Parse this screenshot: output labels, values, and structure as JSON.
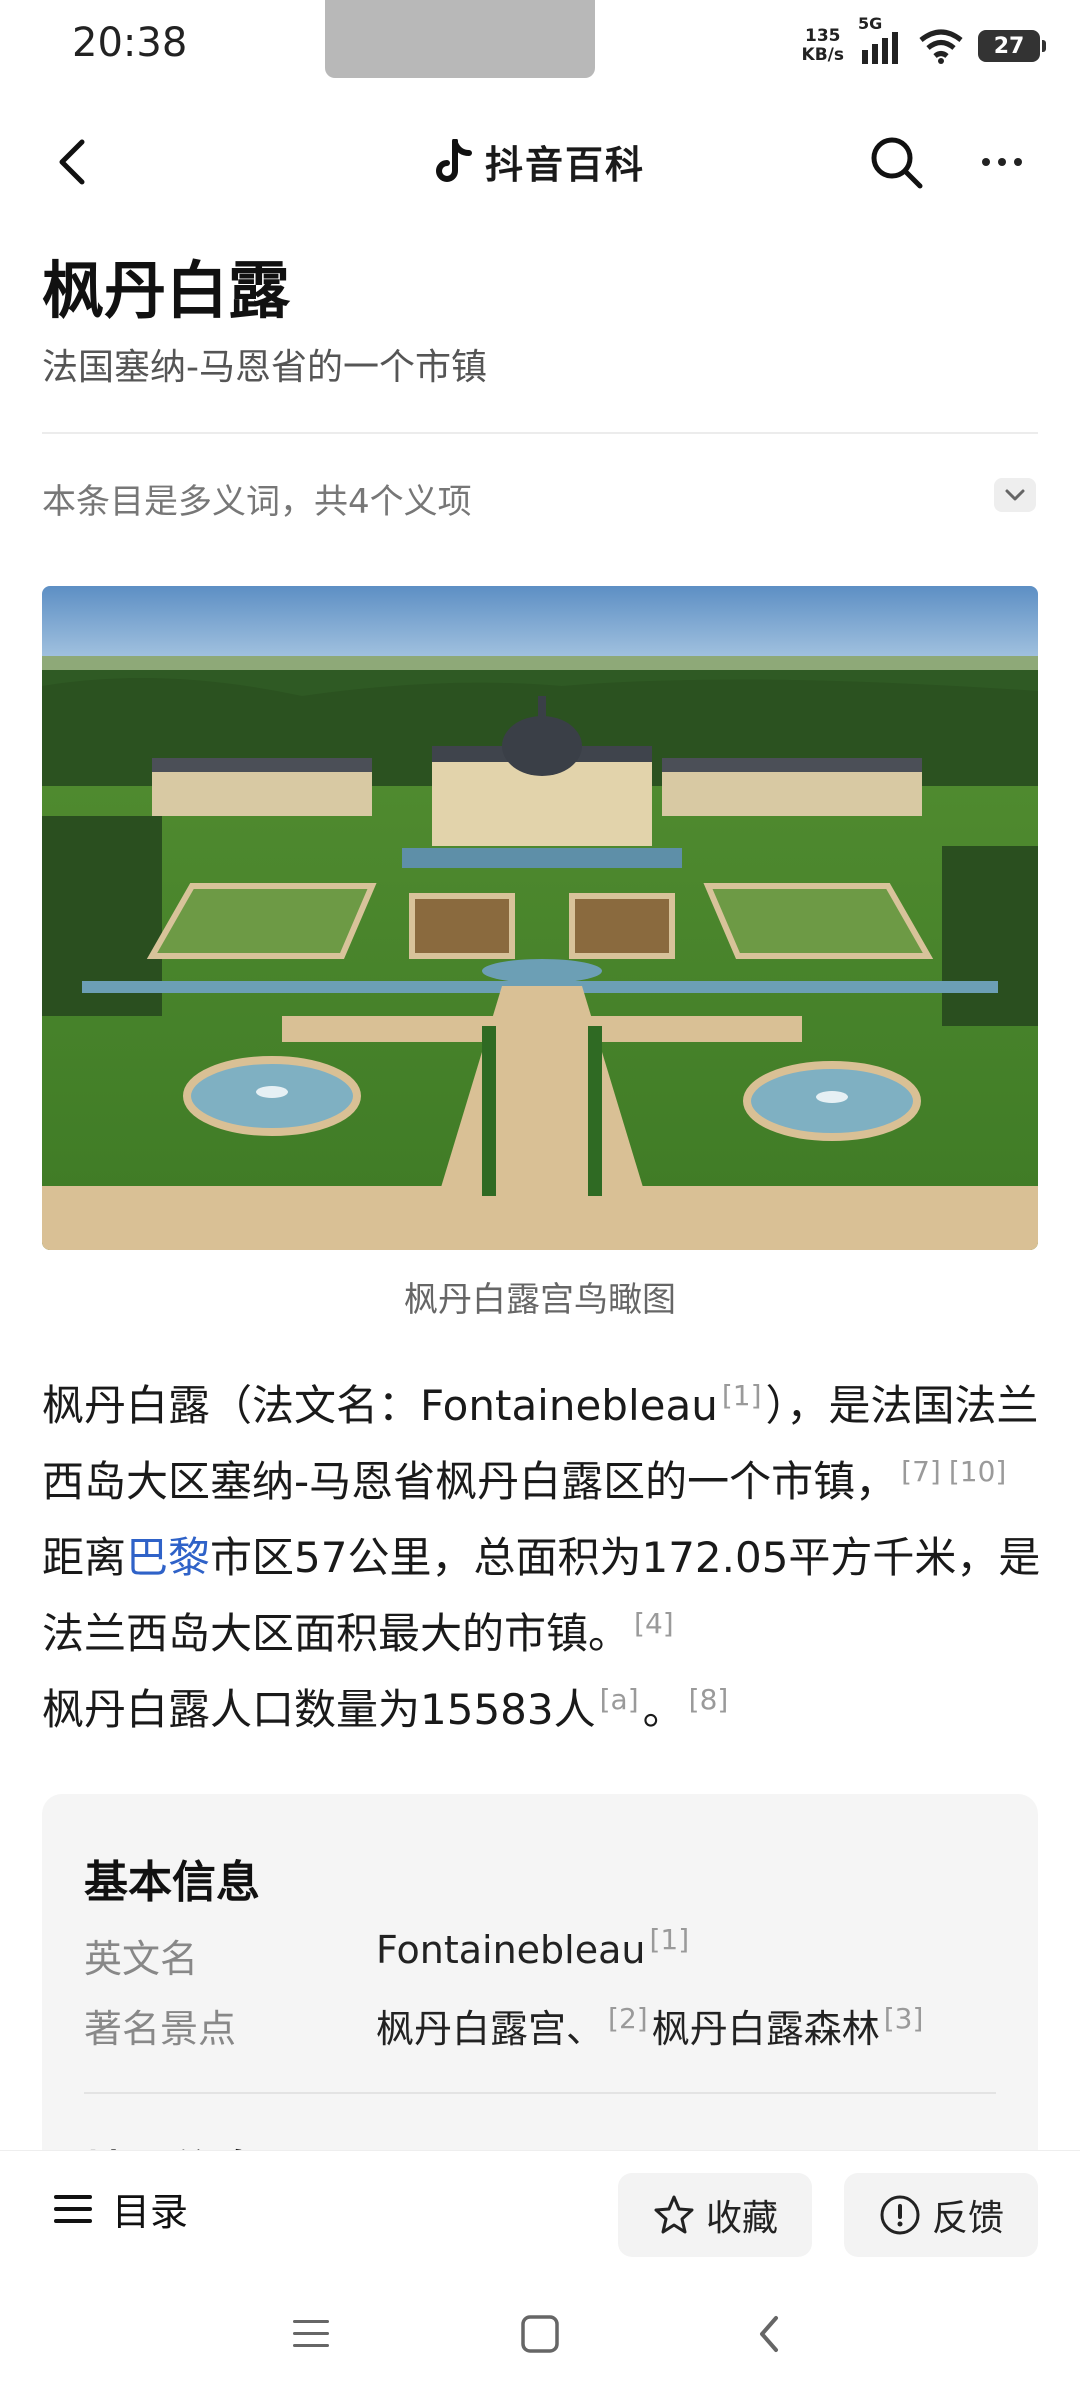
{
  "status_bar": {
    "time": "20:38",
    "net_speed_value": "135",
    "net_speed_unit": "KB/s",
    "network": "5G",
    "battery": "27"
  },
  "nav": {
    "brand": "抖音百科",
    "icons": [
      "back-icon",
      "tiktok-logo-icon",
      "search-icon",
      "more-icon"
    ]
  },
  "article": {
    "title": "枫丹白露",
    "subtitle": "法国塞纳-马恩省的一个市镇",
    "polysemy_note": "本条目是多义词，共4个义项",
    "image_caption": "枫丹白露宫鸟瞰图",
    "intro": {
      "p1": "枫丹白露（法文名：Fontainebleau",
      "r1": "[1]",
      "p2": "），是法国法兰西岛大区塞纳-马恩省枫丹白露区的一个市镇，",
      "r2": "[7]",
      "r3": "[10]",
      "p3": "距离",
      "link": "巴黎",
      "p4": "市区57公里，总面积为172.05平方千米，是法兰西岛大区面积最大的市镇。",
      "r4": "[4]",
      "p5": "枫丹白露人口数量为15583人",
      "r5": "[a]",
      "p6": "。",
      "r6": "[8]"
    }
  },
  "infobox": {
    "title": "基本信息",
    "rows": [
      {
        "key": "英文名",
        "value": "Fontainebleau",
        "ref": "[1]"
      },
      {
        "key": "著名景点",
        "value_a": "枫丹白露宫、",
        "ref_a": "[2]",
        "value_b": "枫丹白露森林",
        "ref_b": "[3]"
      }
    ],
    "next_section_title": "地理信息"
  },
  "bottom_bar": {
    "toc_label": "目录",
    "favorite_label": "收藏",
    "feedback_label": "反馈"
  },
  "colors": {
    "link": "#2f62c8",
    "infobox_bg": "#f5f5f5",
    "button_bg": "#f3f3f3"
  }
}
